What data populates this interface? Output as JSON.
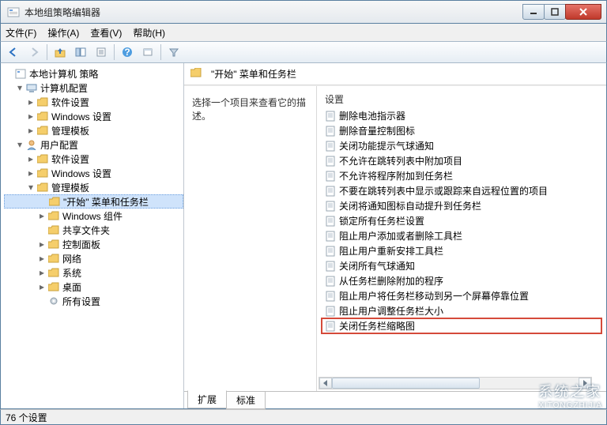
{
  "window": {
    "title": "本地组策略编辑器"
  },
  "menu": {
    "file": "文件(F)",
    "action": "操作(A)",
    "view": "查看(V)",
    "help": "帮助(H)"
  },
  "tree": {
    "root": "本地计算机 策略",
    "computer": "计算机配置",
    "computer_children": {
      "software": "软件设置",
      "windows": "Windows 设置",
      "admin": "管理模板"
    },
    "user": "用户配置",
    "user_children": {
      "software": "软件设置",
      "windows": "Windows 设置",
      "admin": "管理模板",
      "admin_children": {
        "start_taskbar": "\"开始\" 菜单和任务栏",
        "win_components": "Windows 组件",
        "shared_folders": "共享文件夹",
        "control_panel": "控制面板",
        "network": "网络",
        "system": "系统",
        "desktop": "桌面",
        "all_settings": "所有设置"
      }
    }
  },
  "right": {
    "header": "\"开始\" 菜单和任务栏",
    "desc_prompt": "选择一个项目来查看它的描述。",
    "col_setting": "设置",
    "tabs": {
      "extended": "扩展",
      "standard": "标准"
    }
  },
  "settings": [
    "删除电池指示器",
    "删除音量控制图标",
    "关闭功能提示气球通知",
    "不允许在跳转列表中附加项目",
    "不允许将程序附加到任务栏",
    "不要在跳转列表中显示或跟踪来自远程位置的项目",
    "关闭将通知图标自动提升到任务栏",
    "锁定所有任务栏设置",
    "阻止用户添加或者删除工具栏",
    "阻止用户重新安排工具栏",
    "关闭所有气球通知",
    "从任务栏删除附加的程序",
    "阻止用户将任务栏移动到另一个屏幕停靠位置",
    "阻止用户调整任务栏大小",
    "关闭任务栏缩略图"
  ],
  "highlight_index": 14,
  "status": {
    "count": "76 个设置"
  },
  "watermark": {
    "main": "系统之家",
    "sub": "XITONGZHIJIA"
  }
}
